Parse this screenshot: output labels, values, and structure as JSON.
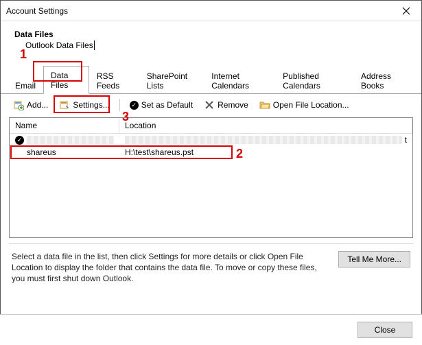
{
  "window": {
    "title": "Account Settings"
  },
  "header": {
    "title": "Data Files",
    "subtitle": "Outlook Data Files"
  },
  "tabs": [
    {
      "label": "Email",
      "active": false
    },
    {
      "label": "Data Files",
      "active": true
    },
    {
      "label": "RSS Feeds",
      "active": false
    },
    {
      "label": "SharePoint Lists",
      "active": false
    },
    {
      "label": "Internet Calendars",
      "active": false
    },
    {
      "label": "Published Calendars",
      "active": false
    },
    {
      "label": "Address Books",
      "active": false
    }
  ],
  "toolbar": {
    "add": "Add...",
    "settings": "Settings...",
    "set_default": "Set as Default",
    "remove": "Remove",
    "open_location": "Open File Location..."
  },
  "columns": {
    "name": "Name",
    "location": "Location"
  },
  "rows": [
    {
      "default": true,
      "name": "",
      "location": "",
      "redacted": true
    },
    {
      "default": false,
      "name": "shareus",
      "location": "H:\\test\\shareus.pst",
      "redacted": false
    }
  ],
  "info_text": "Select a data file in the list, then click Settings for more details or click Open File Location to display the folder that contains the data file. To move or copy these files, you must first shut down Outlook.",
  "buttons": {
    "tell_me_more": "Tell Me More...",
    "close": "Close"
  },
  "annotations": {
    "n1": "1",
    "n2": "2",
    "n3": "3"
  }
}
